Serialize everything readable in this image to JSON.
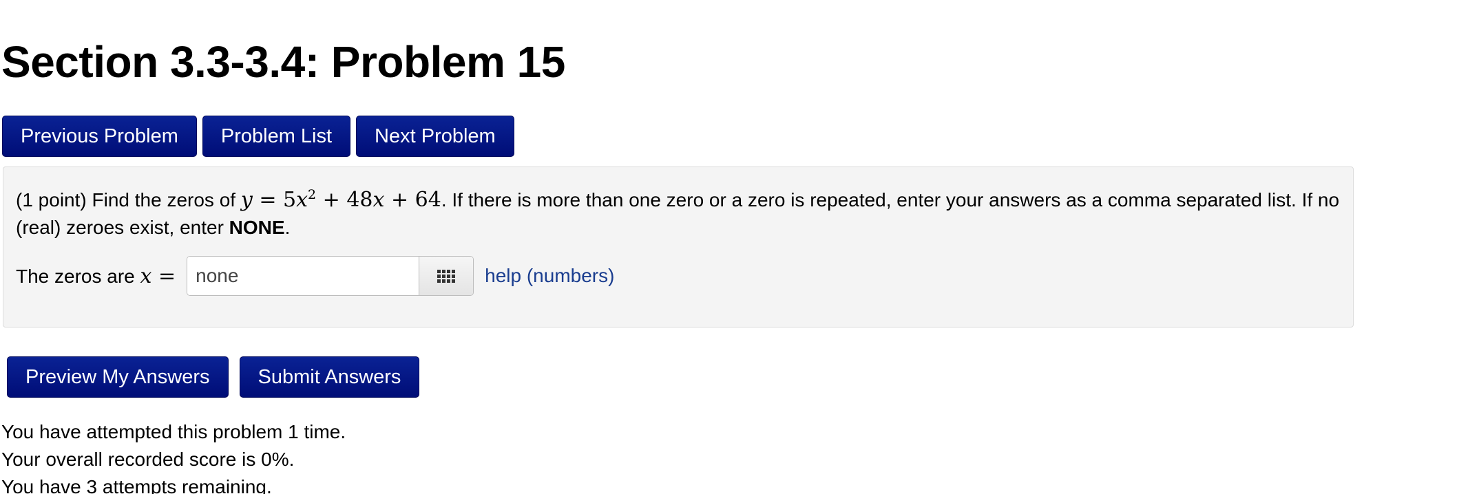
{
  "header": {
    "title": "Section 3.3-3.4: Problem 15"
  },
  "nav": {
    "previous_label": "Previous Problem",
    "list_label": "Problem List",
    "next_label": "Next Problem"
  },
  "problem": {
    "intro": "(1 point) Find the zeros of ",
    "equation": {
      "lhs": "y",
      "equals": " = ",
      "coef1": "5",
      "var1": "x",
      "exp1": "2",
      "plus1": " + ",
      "coef2": "48",
      "var2": "x",
      "plus2": " + ",
      "const": "64"
    },
    "instructions_before": ". If there is more than one zero or a zero is repeated, enter your answers as a comma separated list. If no (real) zeroes exist, enter ",
    "instructions_bold": "NONE",
    "instructions_after": ".",
    "answer_label_text": "The zeros are ",
    "answer_var": "x",
    "answer_equals": " =",
    "answer_value": "none",
    "keypad_icon": "grid-keypad-icon",
    "help_link": "help (numbers)"
  },
  "actions": {
    "preview_label": "Preview My Answers",
    "submit_label": "Submit Answers"
  },
  "status": {
    "attempts": "You have attempted this problem 1 time.",
    "score": "Your overall recorded score is 0%.",
    "remaining": "You have 3 attempts remaining."
  },
  "colors": {
    "button_bg": "#0a2294",
    "panel_bg": "#f4f4f4",
    "link": "#1a3d8f"
  }
}
